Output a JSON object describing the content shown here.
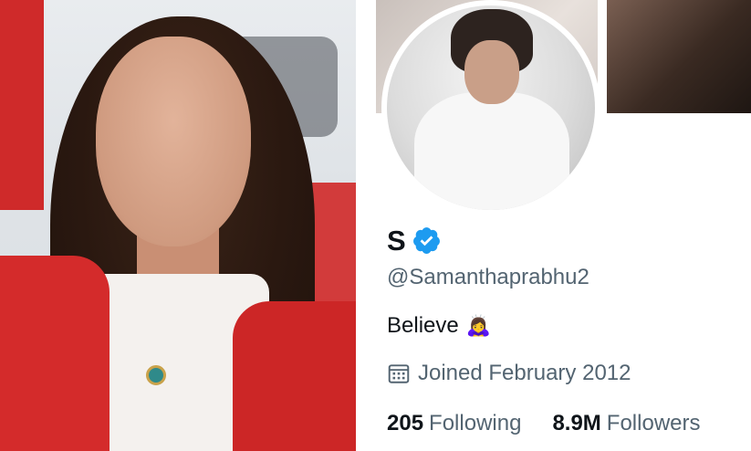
{
  "profile": {
    "display_name": "S",
    "handle": "@Samanthaprabhu2",
    "bio": "Believe",
    "bio_emoji": "🙇‍♀️",
    "joined": "Joined February 2012",
    "following_count": "205",
    "following_label": "Following",
    "followers_count": "8.9M",
    "followers_label": "Followers"
  },
  "icons": {
    "verified": "verified-badge-icon",
    "calendar": "calendar-icon"
  },
  "colors": {
    "verified_blue": "#1d9bf0",
    "text_primary": "#0f1419",
    "text_secondary": "#536471"
  }
}
